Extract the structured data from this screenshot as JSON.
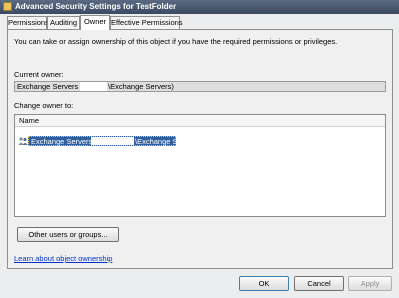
{
  "window": {
    "title": "Advanced Security Settings for TestFolder",
    "icon": "folder-icon"
  },
  "tabs": [
    {
      "label": "Permissions",
      "active": false
    },
    {
      "label": "Auditing",
      "active": false
    },
    {
      "label": "Owner",
      "active": true
    },
    {
      "label": "Effective Permissions",
      "active": false
    }
  ],
  "owner_tab": {
    "info_text": "You can take or assign ownership of this object if you have the required permissions or privileges.",
    "current_owner_label": "Current owner:",
    "current_owner_prefix": "Exchange Servers",
    "current_owner_suffix": "\\Exchange Servers)",
    "change_owner_label": "Change owner to:",
    "list_header_name": "Name",
    "list_items": [
      {
        "prefix": "Exchange Servers",
        "suffix": "\\Exchange Servers)",
        "icon": "user-group-icon",
        "selected": true
      }
    ],
    "other_users_button": "Other users or groups...",
    "learn_link": "Learn about object ownership"
  },
  "footer": {
    "ok": "OK",
    "cancel": "Cancel",
    "apply": "Apply"
  },
  "colors": {
    "selection": "#2f5f9e",
    "link": "#0033cc",
    "titlebar": "#3b4a60"
  }
}
